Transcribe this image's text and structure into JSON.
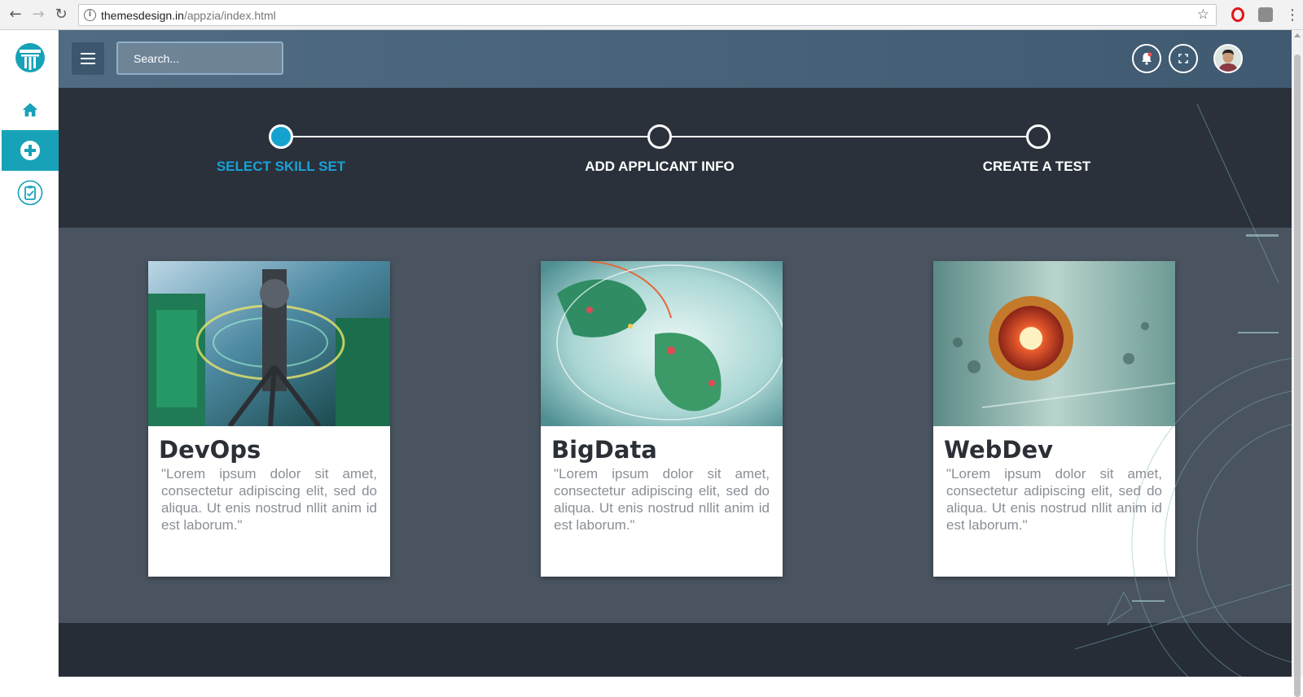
{
  "browser": {
    "url_host": "themesdesign.in",
    "url_path": "/appzia/index.html",
    "icons": [
      "back-arrow-icon",
      "forward-arrow-icon",
      "reload-icon",
      "info-icon",
      "star-icon",
      "opera-icon",
      "extension-icon",
      "more-menu-icon"
    ]
  },
  "header": {
    "search_placeholder": "Search..."
  },
  "sidebar": {
    "items": [
      {
        "name": "home",
        "icon": "home-icon"
      },
      {
        "name": "add",
        "icon": "plus-circle-icon",
        "active": true
      },
      {
        "name": "tests",
        "icon": "clipboard-check-icon"
      }
    ]
  },
  "stepper": {
    "steps": [
      {
        "label": "SELECT SKILL SET",
        "active": true
      },
      {
        "label": "ADD APPLICANT INFO",
        "active": false
      },
      {
        "label": "CREATE A TEST",
        "active": false
      }
    ]
  },
  "cards": [
    {
      "title": "DevOps",
      "text": "\"Lorem ipsum dolor sit amet, consectetur adipiscing elit, sed do aliqua. Ut enis nostrud nllit anim id est laborum.\""
    },
    {
      "title": "BigData",
      "text": "\"Lorem ipsum dolor sit amet, consectetur adipiscing elit, sed do aliqua. Ut enis nostrud nllit anim id est laborum.\""
    },
    {
      "title": "WebDev",
      "text": "\"Lorem ipsum dolor sit amet, consectetur adipiscing elit, sed do aliqua. Ut enis nostrud nllit anim id est laborum.\""
    }
  ],
  "colors": {
    "accent": "#17a2b8",
    "active_step": "#18a2d6",
    "header": "#4a6479",
    "stepper_bg": "#2a313b",
    "card_area_bg": "#4a5460"
  }
}
